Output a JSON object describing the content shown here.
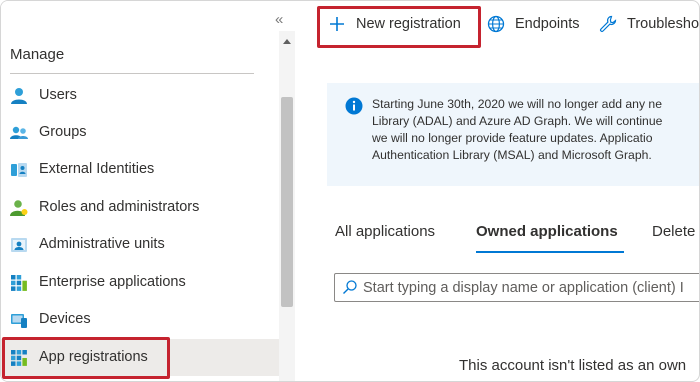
{
  "sidebar": {
    "collapse_glyph": "«",
    "section_title": "Manage",
    "items": [
      {
        "label": "Users",
        "icon": "user-icon"
      },
      {
        "label": "Groups",
        "icon": "group-icon"
      },
      {
        "label": "External Identities",
        "icon": "external-identities-icon"
      },
      {
        "label": "Roles and administrators",
        "icon": "roles-icon"
      },
      {
        "label": "Administrative units",
        "icon": "admin-units-icon"
      },
      {
        "label": "Enterprise applications",
        "icon": "enterprise-apps-icon"
      },
      {
        "label": "Devices",
        "icon": "devices-icon"
      },
      {
        "label": "App registrations",
        "icon": "app-registrations-icon",
        "active": true
      }
    ]
  },
  "toolbar": {
    "new_registration": "New registration",
    "endpoints": "Endpoints",
    "troubleshooting": "Troublesho"
  },
  "info_banner": {
    "lines": [
      "Starting June 30th, 2020 we will no longer add any ne",
      "Library (ADAL) and Azure AD Graph. We will continue",
      "we will no longer provide feature updates. Applicatio",
      "Authentication Library (MSAL) and Microsoft Graph."
    ]
  },
  "tabs": {
    "all": "All applications",
    "owned": "Owned applications",
    "deleted": "Delete"
  },
  "search": {
    "placeholder": "Start typing a display name or application (client) I"
  },
  "empty_message": "This account isn't listed as an own",
  "colors": {
    "accent": "#0078d4",
    "highlight": "#c5232f",
    "info_bg": "#eff6fc"
  }
}
